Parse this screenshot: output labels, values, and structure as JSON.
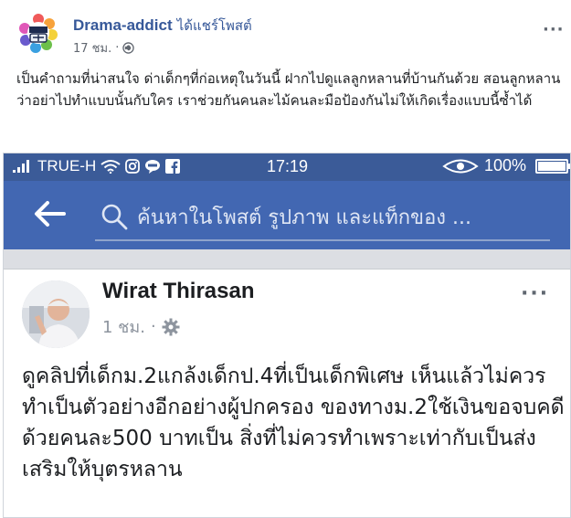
{
  "post": {
    "author": "Drama-addict",
    "shared_text": "ได้แชร์โพสต์",
    "time": "17 ชม.",
    "dot": "·",
    "privacy_icon": "globe-icon",
    "more": "···",
    "caption": "เป็นคำถามที่น่าสนใจ ด่าเด็กๆที่ก่อเหตุในวันนี้ ฝากไปดูแลลูกหลานที่บ้านกันด้วย สอนลูกหลานว่าอย่าไปทำแบบนั้นกับใคร เราช่วยกันคนละไม้คนละมือป้องกันไม่ให้เกิดเรื่องแบบนี้ซ้ำได้"
  },
  "screenshot": {
    "status": {
      "carrier": "TRUE-H",
      "time": "17:19",
      "battery": "100%",
      "battery_level": 1.0
    },
    "search": {
      "placeholder": "ค้นหาในโพสต์ รูปภาพ และแท็กของ ..."
    },
    "inner_post": {
      "author": "Wirat Thirasan",
      "time": "1 ชม.",
      "dot": "·",
      "more": "···",
      "body": "ดูคลิปที่เด็กม.2แกล้งเด็กป.4ที่เป็นเด็กพิเศษ เห็นแล้วไม่ควรทำเป็นตัวอย่างอีกอย่างผู้ปกครอง ของทางม.2ใช้เงินขอจบคดีด้วยคนละ500 บาทเป็น สิ่งที่ไม่ควรทำเพราะเท่ากับเป็นส่งเสริมให้บุตรหลาน"
    }
  },
  "colors": {
    "fb_blue": "#4267b2",
    "status_blue": "#3b5b98",
    "link_blue": "#365899"
  }
}
